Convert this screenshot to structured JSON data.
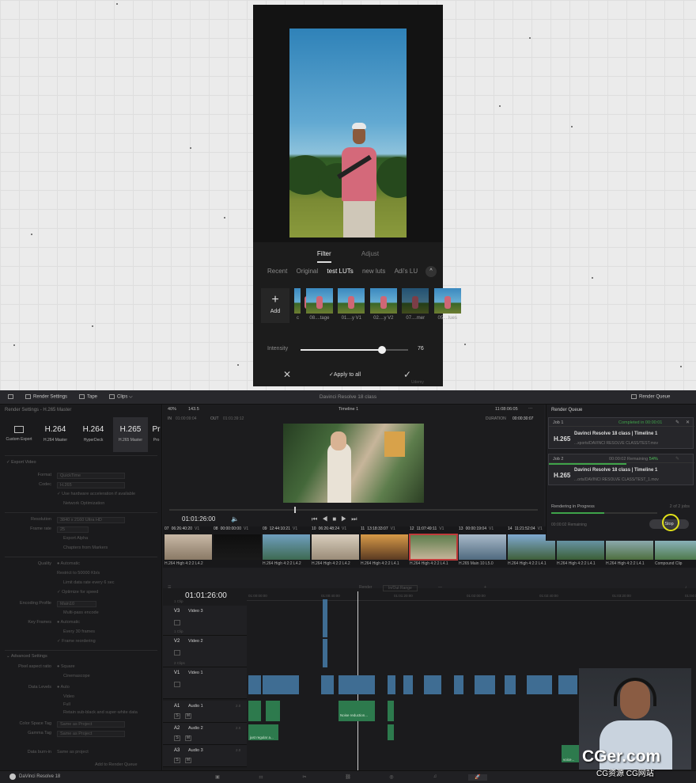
{
  "phone": {
    "tabs": [
      "Filter",
      "Adjust"
    ],
    "categories": [
      "Recent",
      "Original",
      "test LUTs",
      "new luts",
      "Adi's LU"
    ],
    "chevron": "^",
    "add_plus": "+",
    "add_label": "Add",
    "thumbs": [
      "c",
      "08....tage",
      "01....y V1",
      "02....y V2",
      "07....mer",
      "05....lues"
    ],
    "intensity_label": "Intensity",
    "intensity_value": "76",
    "intensity_fraction": 0.76,
    "close_glyph": "✕",
    "apply_label": "✓Apply to all",
    "confirm_glyph": "✓",
    "watermark": "Udemy"
  },
  "resolve": {
    "topbar": {
      "render_settings": "Render Settings",
      "tape": "Tape",
      "clips": "Clips ⌵",
      "app_title": "Davinci Resolve 18 class",
      "render_queue": "Render Queue"
    },
    "left": {
      "header": "Render Settings - H.265 Master",
      "presets": [
        {
          "big": "",
          "sub": "Custom Export"
        },
        {
          "big": "H.264",
          "sub": "H.264 Master"
        },
        {
          "big": "H.264",
          "sub": "HyperDeck"
        },
        {
          "big": "H.265",
          "sub": "H.265 Master"
        },
        {
          "big": "Pr",
          "sub": "Pro"
        }
      ],
      "export_video": "✓  Export Video",
      "format_label": "Format",
      "format_value": "QuickTime",
      "codec_label": "Codec",
      "codec_value": "H.265",
      "hw_accel": "✓  Use hardware acceleration if available",
      "network_opt": "Network Optimization",
      "resolution_label": "Resolution",
      "resolution_value": "3840 x 2160 Ultra HD",
      "framerate_label": "Frame rate",
      "framerate_value": "25",
      "export_alpha": "Export Alpha",
      "chapters": "Chapters from Markers",
      "quality_label": "Quality",
      "quality_value": "● Automatic",
      "restrict": "Restrict to   50000   Kb/s",
      "limit_rate": "Limit data rate every   6   sec",
      "optimize": "✓  Optimize for speed",
      "encoding_label": "Encoding Profile",
      "encoding_value": "Main10",
      "multipass": "Multi-pass encode",
      "keyframes_label": "Key Frames",
      "keyframes_value": "● Automatic",
      "every": "Every   30   frames",
      "reordering": "✓  Frame reordering",
      "advanced": "⌄  Advanced Settings",
      "pixel_aspect_label": "Pixel aspect ratio",
      "pixel_aspect_value": "● Square",
      "cinemascope": "Cinemascope",
      "data_levels_label": "Data Levels",
      "data_levels_value": "● Auto",
      "video_level": "Video",
      "full_level": "Full",
      "retain": "Retain sub-black and super-white data",
      "colorspace_label": "Color Space Tag",
      "colorspace_value": "Same as Project",
      "gamma_label": "Gamma Tag",
      "gamma_value": "Same as Project",
      "data_burnin_label": "Data burn-in",
      "data_burnin_value": "Same as project",
      "add_to_queue": "Add to Render Queue"
    },
    "viewer": {
      "zoom": "40%",
      "zoom_value": "143.5",
      "timeline_name": "Timeline 1",
      "timecode_top": "11:08:06:05",
      "in_label": "IN",
      "in_value": "01:00:09:04",
      "out_label": "OUT",
      "out_value": "01:01:39:12",
      "duration_label": "DURATION",
      "duration_value": "00:00:30:07",
      "timecode": "01:01:26:00",
      "transport": "⏮◀■▶⏭",
      "vol_glyph": "🔈",
      "scrub_fraction": 0.34
    },
    "clips": [
      {
        "num": "07",
        "tc": "06:26:40:20",
        "trk": "V1",
        "codec": "H.264 High 4:2:2 L4.2",
        "c1": "#c8b8a6",
        "c2": "#8a7a66"
      },
      {
        "num": "08",
        "tc": "00:00:00:00",
        "trk": "V1",
        "codec": "",
        "c1": "#0e0e0e",
        "c2": "#1a1a1a"
      },
      {
        "num": "09",
        "tc": "12:44:10:21",
        "trk": "V1",
        "codec": "H.264 High 4:2:2 L4.2",
        "c1": "#6f9fbf",
        "c2": "#3e6a52"
      },
      {
        "num": "10",
        "tc": "06:26:48:24",
        "trk": "V1",
        "codec": "H.264 High 4:2:2 L4.2",
        "c1": "#d9cdbd",
        "c2": "#9a8c78"
      },
      {
        "num": "11",
        "tc": "13:18:33:07",
        "trk": "V1",
        "codec": "H.264 High 4:2:2 L4.1",
        "c1": "#d89a48",
        "c2": "#5b3a22"
      },
      {
        "num": "12",
        "tc": "11:07:49:11",
        "trk": "V1",
        "codec": "H.264 High 4:2:2 L4.1",
        "c1": "#5b7c4b",
        "c2": "#c7b59a"
      },
      {
        "num": "13",
        "tc": "00:00:19:04",
        "trk": "V1",
        "codec": "H.265 Main 10 L5.0",
        "c1": "#a8b9c9",
        "c2": "#506a7f"
      },
      {
        "num": "14",
        "tc": "11:21:52:04",
        "trk": "V1",
        "codec": "H.264 High 4:2:2 L4.1",
        "c1": "#7fa9d1",
        "c2": "#3f5f3a"
      },
      {
        "num": "15",
        "tc": "11:23:01:10",
        "trk": "V1",
        "codec": "H.264 High 4:2:2 L4.1",
        "c1": "#76a4c8",
        "c2": "#3b5f36"
      },
      {
        "num": "16",
        "tc": "11:52:14:14",
        "trk": "V1",
        "codec": "H.264 High 4:2:2 L4.1",
        "c1": "#9fbcd1",
        "c2": "#4e6f3f"
      },
      {
        "num": "17",
        "tc": "00:00:00:00",
        "trk": "V1",
        "codec": "Compound Clip",
        "c1": "#9cc3dd",
        "c2": "#4f7a4c"
      }
    ],
    "timeline": {
      "render_label": "Render",
      "range_label": "In/Out Range",
      "timecode": "01:01:26:00",
      "ruler": [
        "01:00:00:00",
        "01:00:40:00",
        "01:01:20:00",
        "01:02:00:00",
        "01:02:40:00",
        "01:03:20:00",
        "01:04:00:00"
      ],
      "tracks": [
        {
          "id": "V3",
          "name": "Video 3",
          "sub": "1 Clip"
        },
        {
          "id": "V2",
          "name": "Video 2",
          "sub": "1 Clip"
        },
        {
          "id": "V1",
          "name": "Video 1",
          "sub": "2 Clips"
        },
        {
          "id": "A1",
          "name": "Audio 1",
          "sub": "2.0"
        },
        {
          "id": "A2",
          "name": "Audio 2",
          "sub": "2.0"
        },
        {
          "id": "A3",
          "name": "Audio 3",
          "sub": "2.0"
        }
      ],
      "s_label": "S",
      "m_label": "M",
      "clip_label_a1": "Noise reduction...",
      "clip_label_a2": "just regular a...",
      "clip_label_a3": "voice..."
    },
    "render_queue": {
      "title": "Render Queue",
      "jobs": [
        {
          "name": "Job 1",
          "status": "Completed in 00:00:01",
          "codec": "H.265",
          "title": "Davinci Resolve 18 class | Timeline 1",
          "path": "...xports/DAVINCI RESOLVE CLASS/TEST.mov"
        },
        {
          "name": "Job 2",
          "status": "00:00:02 Remaining",
          "pct": "54%",
          "codec": "H.265",
          "title": "Davinci Resolve 18 class | Timeline 1",
          "path": "...orts/DAVINCI RESOLVE CLASS/TEST_1.mov"
        }
      ],
      "job2_progress": 0.54,
      "overall_progress": 0.5,
      "rendering_label": "Rendering in Progress",
      "jobs_count": "2 of 2 jobs",
      "remaining": "00:00:02 Remaining",
      "stop_label": "Stop"
    },
    "pagebar": {
      "app_name": "DaVinci Resolve 18",
      "pages": [
        "▣",
        "⚏",
        "✂",
        "⛓",
        "◎",
        "♫",
        "🚀"
      ]
    }
  },
  "watermark": {
    "big": "CGer.com",
    "small": "CG资源 CG网站"
  },
  "colors": {
    "accent_green": "#3fa34a",
    "selected_clip": "#c03b3b",
    "stop_ring": "#e2e21a",
    "video_clip": "#3f6d93",
    "audio_clip": "#2d7a4d"
  }
}
